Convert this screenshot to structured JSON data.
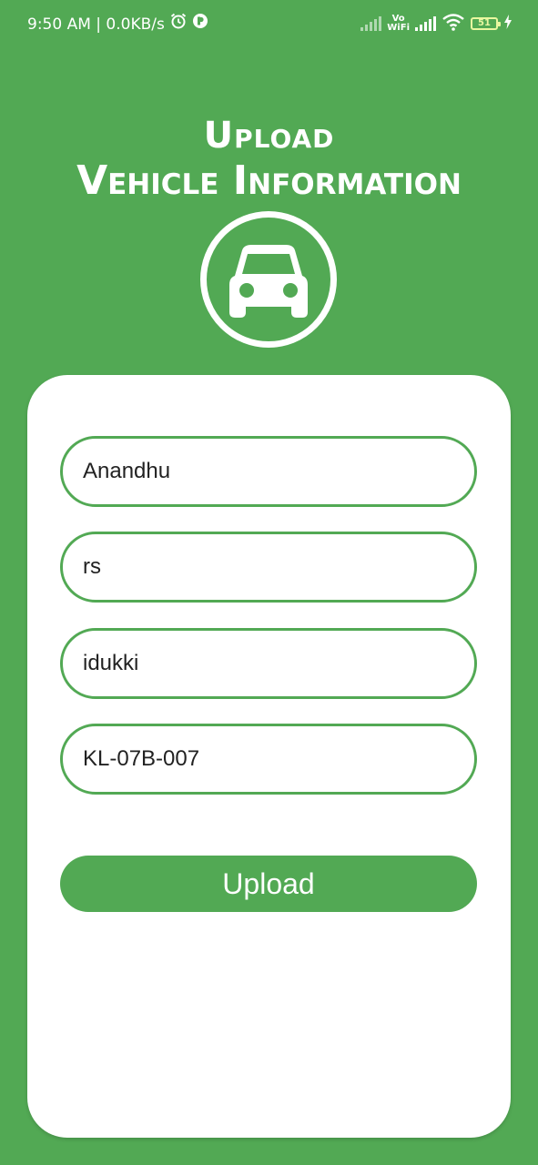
{
  "status_bar": {
    "time_net": "9:50 AM | 0.0KB/s",
    "vowifi_top": "Vo",
    "vowifi_bottom": "WiFi",
    "battery": "51",
    "icons": [
      "alarm-icon",
      "app-notification-icon",
      "signal-icon",
      "vowifi-icon",
      "wifi-icon",
      "battery-icon",
      "charging-icon"
    ]
  },
  "header": {
    "title_line1": "Upload",
    "title_line2": "Vehicle Information",
    "icon": "car-icon"
  },
  "form": {
    "fields": [
      {
        "value": "Anandhu"
      },
      {
        "value": "rs"
      },
      {
        "value": "idukki"
      },
      {
        "value": "KL-07B-007"
      }
    ],
    "upload_label": "Upload"
  },
  "colors": {
    "brand": "#52a954",
    "card": "#ffffff"
  }
}
